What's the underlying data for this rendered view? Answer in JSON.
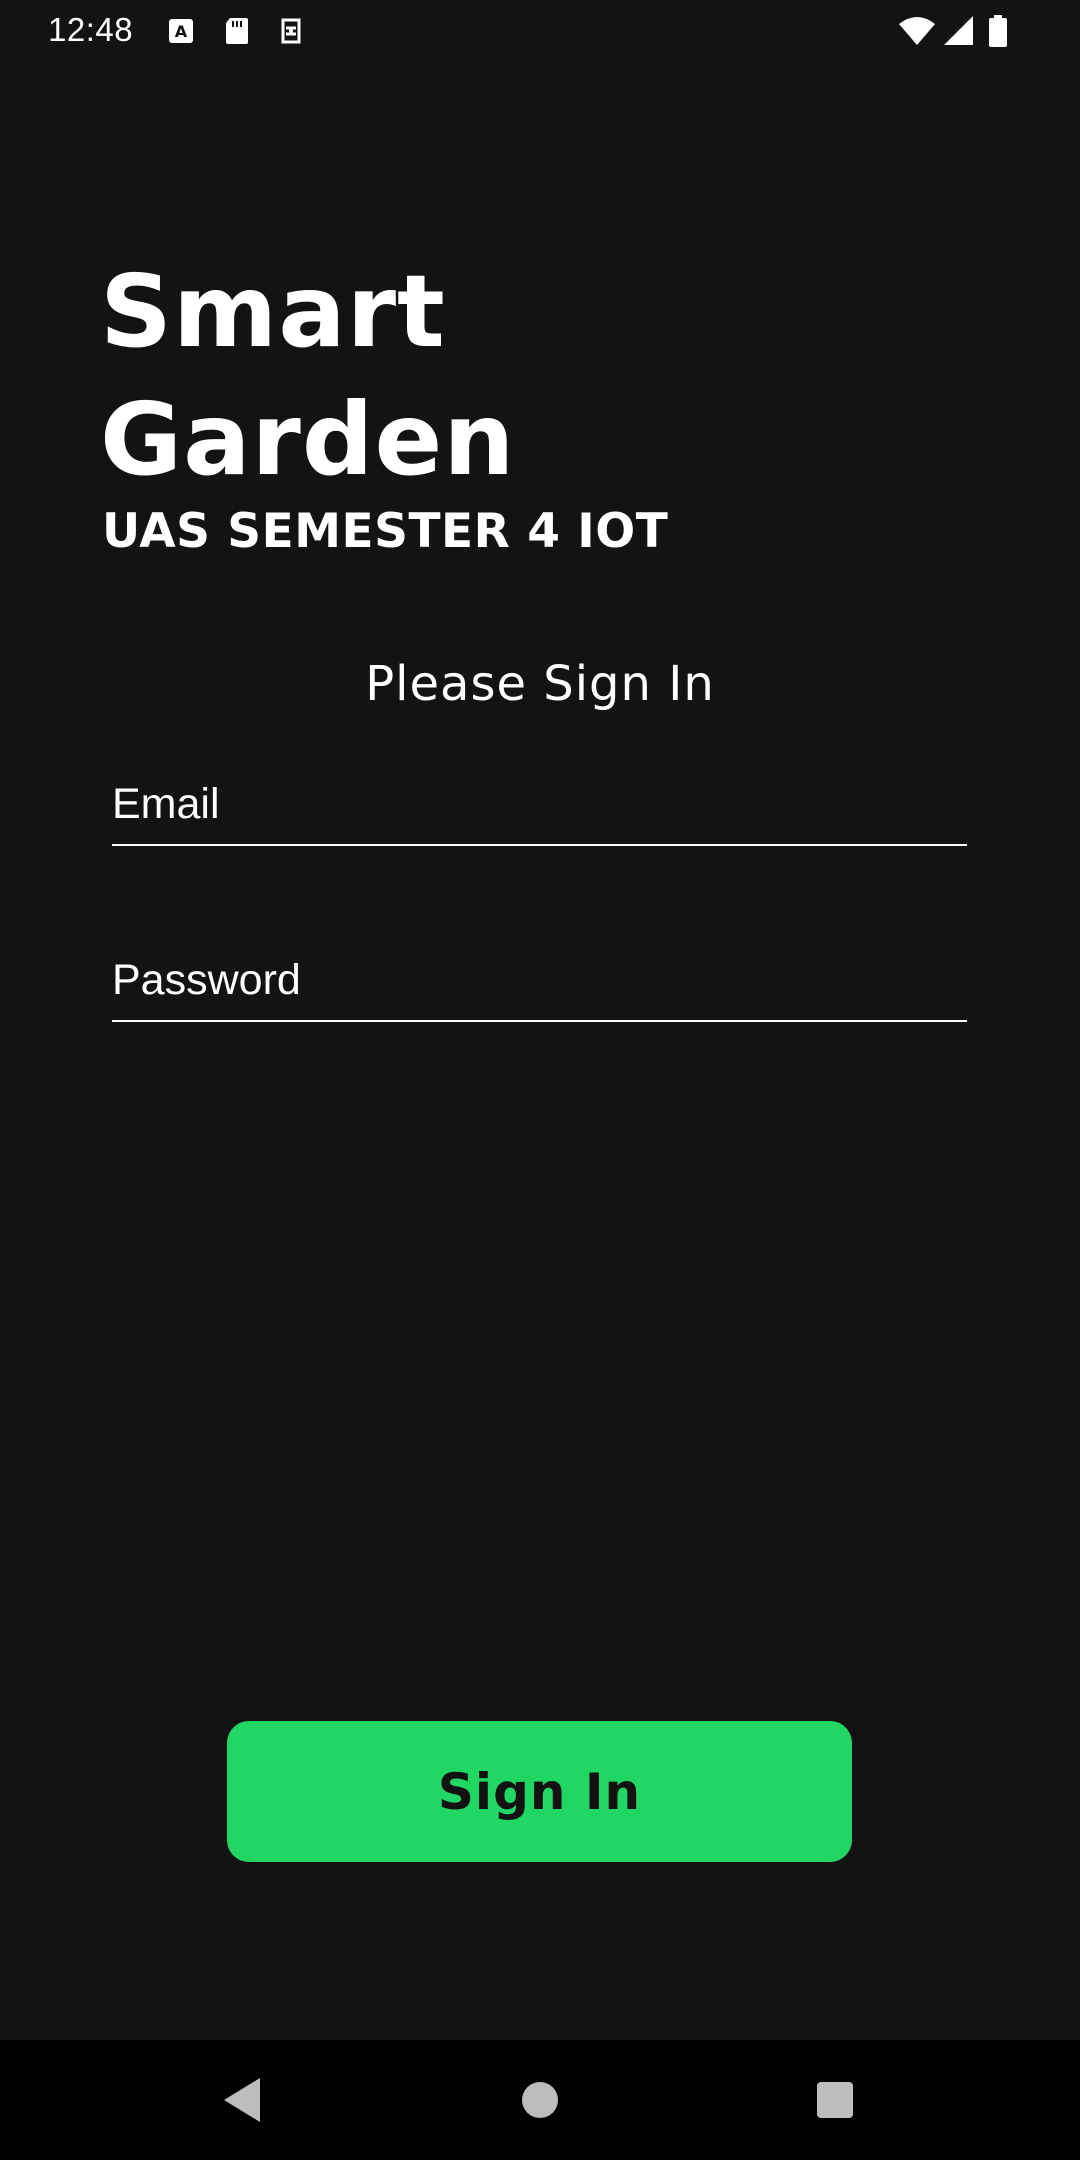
{
  "status_bar": {
    "time": "12:48",
    "left_icons": [
      "font-a-icon",
      "sd-card-icon",
      "sim-sync-icon"
    ],
    "right_icons": [
      "wifi-icon",
      "cell-signal-icon",
      "battery-icon"
    ]
  },
  "header": {
    "title_line1": "Smart",
    "title_line2": "Garden",
    "subtitle": "UAS SEMESTER 4 IOT"
  },
  "form": {
    "prompt": "Please Sign In",
    "email_placeholder": "Email",
    "email_value": "",
    "password_placeholder": "Password",
    "password_value": ""
  },
  "actions": {
    "signin_label": "Sign In"
  },
  "navigation_bar": {
    "icons": [
      "back-icon",
      "home-icon",
      "recents-icon"
    ]
  },
  "colors": {
    "background": "#131313",
    "accent": "#21d763",
    "text": "#ffffff",
    "button_text": "#121212",
    "nav_bar": "#000000"
  }
}
